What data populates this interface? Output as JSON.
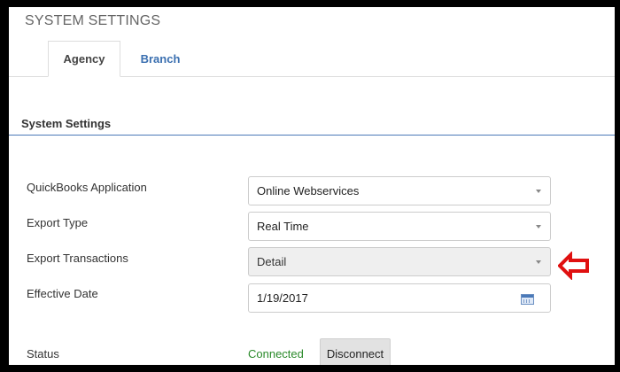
{
  "page": {
    "title": "SYSTEM SETTINGS"
  },
  "tabs": [
    {
      "label": "Agency",
      "active": true
    },
    {
      "label": "Branch",
      "active": false
    }
  ],
  "section": {
    "title": "System Settings"
  },
  "fields": {
    "quickbooks_application": {
      "label": "QuickBooks Application",
      "value": "Online Webservices"
    },
    "export_type": {
      "label": "Export Type",
      "value": "Real Time"
    },
    "export_transactions": {
      "label": "Export Transactions",
      "value": "Detail",
      "disabled": true
    },
    "effective_date": {
      "label": "Effective Date",
      "value": "1/19/2017"
    },
    "status": {
      "label": "Status",
      "value": "Connected"
    }
  },
  "buttons": {
    "disconnect": "Disconnect"
  },
  "icons": {
    "dropdown": "chevron-down-icon",
    "calendar": "calendar-icon",
    "annotation": "red-arrow-left-icon"
  },
  "colors": {
    "tab_link": "#3a6fb0",
    "section_rule": "#4a79b8",
    "status_connected": "#2a8a2a",
    "annotation_arrow": "#e01010"
  }
}
